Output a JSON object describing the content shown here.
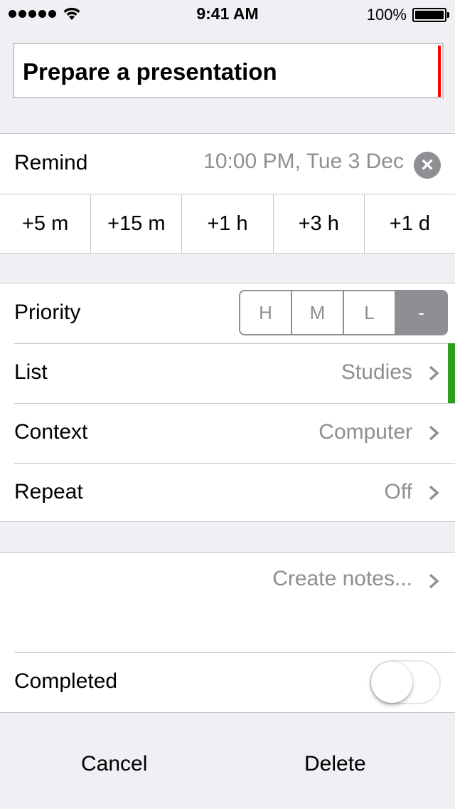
{
  "status_bar": {
    "time": "9:41 AM",
    "battery_percent": "100%",
    "signal_bars": 5,
    "wifi_icon": "wifi-icon"
  },
  "task": {
    "title": "Prepare a presentation",
    "title_accent_color": "#ff0000"
  },
  "reminder": {
    "label": "Remind",
    "value": "10:00 PM, Tue 3 Dec",
    "clear_icon": "clear-icon",
    "quick_adds": [
      "+5 m",
      "+15 m",
      "+1 h",
      "+3 h",
      "+1 d"
    ]
  },
  "priority": {
    "label": "Priority",
    "options": [
      "H",
      "M",
      "L",
      "-"
    ],
    "selected": "-"
  },
  "list": {
    "label": "List",
    "value": "Studies",
    "accent_color": "#2d9f1e"
  },
  "context": {
    "label": "Context",
    "value": "Computer"
  },
  "repeat": {
    "label": "Repeat",
    "value": "Off"
  },
  "notes": {
    "placeholder": "Create notes..."
  },
  "completed": {
    "label": "Completed",
    "on": false
  },
  "bottom_bar": {
    "cancel_label": "Cancel",
    "delete_label": "Delete"
  }
}
